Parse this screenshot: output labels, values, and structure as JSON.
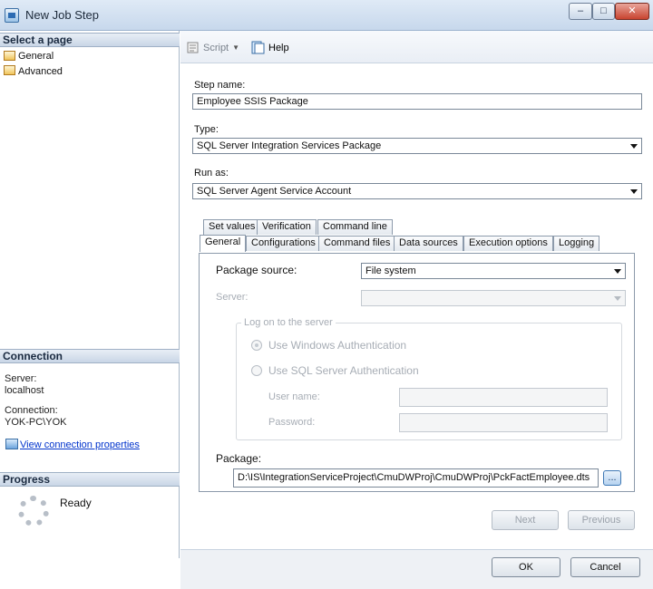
{
  "window": {
    "title": "New Job Step",
    "minimize": "–",
    "maximize": "□",
    "close": "✕"
  },
  "left": {
    "select_page_header": "Select a page",
    "pages": [
      {
        "label": "General"
      },
      {
        "label": "Advanced"
      }
    ],
    "connection_header": "Connection",
    "server_label": "Server:",
    "server_value": "localhost",
    "connection_label": "Connection:",
    "connection_value": "YOK-PC\\YOK",
    "view_link": "View connection properties",
    "progress_header": "Progress",
    "progress_status": "Ready"
  },
  "toolbar": {
    "script_label": "Script",
    "help_label": "Help"
  },
  "form": {
    "step_name_label": "Step name:",
    "step_name_value": "Employee SSIS Package",
    "type_label": "Type:",
    "type_value": "SQL Server Integration Services Package",
    "run_as_label": "Run as:",
    "run_as_value": "SQL Server Agent Service Account"
  },
  "tabs": {
    "row1": [
      "Set values",
      "Verification",
      "Command line"
    ],
    "row2": [
      "General",
      "Configurations",
      "Command files",
      "Data sources",
      "Execution options",
      "Logging"
    ],
    "active": "General"
  },
  "general": {
    "package_source_label": "Package source:",
    "package_source_value": "File system",
    "server_label": "Server:",
    "server_value": "",
    "logon_group": "Log on to the server",
    "windows_auth": "Use Windows Authentication",
    "sql_auth": "Use SQL Server Authentication",
    "username_label": "User name:",
    "password_label": "Password:",
    "package_label": "Package:",
    "package_value": "D:\\IS\\IntegrationServiceProject\\CmuDWProj\\CmuDWProj\\PckFactEmployee.dts",
    "browse": "..."
  },
  "nav": {
    "next": "Next",
    "previous": "Previous"
  },
  "footer": {
    "ok": "OK",
    "cancel": "Cancel"
  }
}
